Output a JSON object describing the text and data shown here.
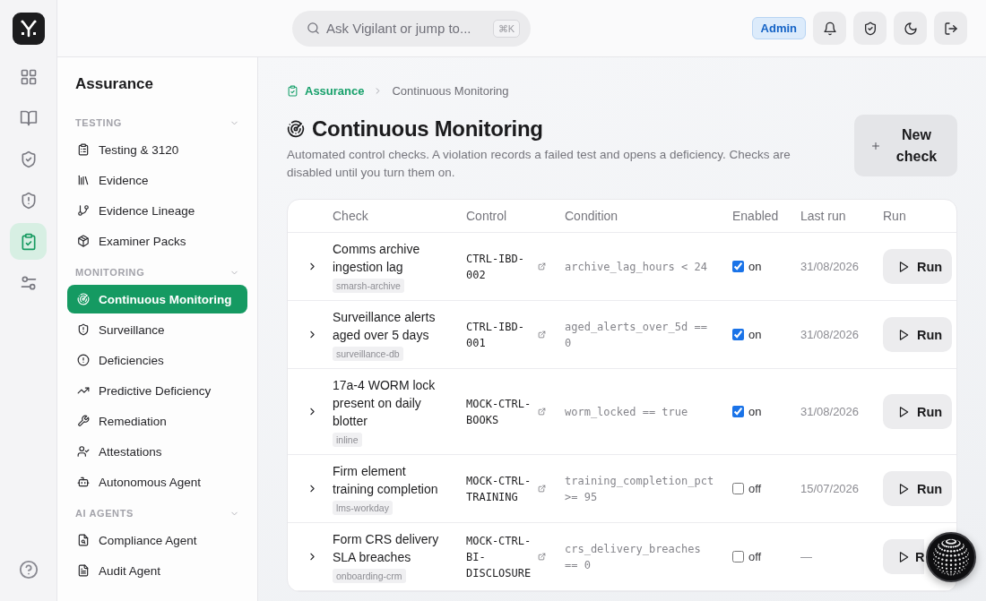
{
  "rail": {
    "items": [
      {
        "selected": false
      },
      {
        "selected": false
      },
      {
        "selected": false
      },
      {
        "selected": false
      },
      {
        "selected": true
      },
      {
        "selected": false
      }
    ]
  },
  "topbar": {
    "search": {
      "placeholder": "Ask Vigilant or jump to...",
      "shortcut": "⌘K"
    },
    "role_badge": "Admin"
  },
  "sidebar": {
    "title": "Assurance",
    "sections": [
      {
        "heading": "TESTING",
        "expanded": true,
        "items": [
          {
            "label": "Testing & 3120",
            "selected": false
          },
          {
            "label": "Evidence",
            "selected": false
          },
          {
            "label": "Evidence Lineage",
            "selected": false
          },
          {
            "label": "Examiner Packs",
            "selected": false
          }
        ]
      },
      {
        "heading": "MONITORING",
        "expanded": true,
        "items": [
          {
            "label": "Continuous Monitoring",
            "selected": true
          },
          {
            "label": "Surveillance",
            "selected": false
          },
          {
            "label": "Deficiencies",
            "selected": false
          },
          {
            "label": "Predictive Deficiency",
            "selected": false
          },
          {
            "label": "Remediation",
            "selected": false
          },
          {
            "label": "Attestations",
            "selected": false
          },
          {
            "label": "Autonomous Agent",
            "selected": false
          }
        ]
      },
      {
        "heading": "AI AGENTS",
        "expanded": true,
        "items": [
          {
            "label": "Compliance Agent",
            "selected": false
          },
          {
            "label": "Audit Agent",
            "selected": false
          }
        ]
      }
    ]
  },
  "breadcrumb": [
    {
      "label": "Assurance",
      "current": false
    },
    {
      "label": "Continuous Monitoring",
      "current": true
    }
  ],
  "page": {
    "title": "Continuous Monitoring",
    "description": "Automated control checks. A violation records a failed test and opens a deficiency. Checks are disabled until you turn them on.",
    "new_button": "New check"
  },
  "table": {
    "columns": [
      "Check",
      "Control",
      "Condition",
      "Enabled",
      "Last run",
      "Run"
    ],
    "rows": [
      {
        "expanded": false,
        "name": "Comms archive ingestion lag",
        "source": "smarsh-archive",
        "control": "CTRL-IBD-002",
        "condition": "archive_lag_hours < 24",
        "enabled": true,
        "enabled_label": "on",
        "last_run": "31/08/2026",
        "run_label": "Run"
      },
      {
        "expanded": false,
        "name": "Surveillance alerts aged over 5 days",
        "source": "surveillance-db",
        "control": "CTRL-IBD-001",
        "condition": "aged_alerts_over_5d == 0",
        "enabled": true,
        "enabled_label": "on",
        "last_run": "31/08/2026",
        "run_label": "Run"
      },
      {
        "expanded": false,
        "name": "17a-4 WORM lock present on daily blotter",
        "source": "inline",
        "control": "MOCK-CTRL-BOOKS",
        "condition": "worm_locked == true",
        "enabled": true,
        "enabled_label": "on",
        "last_run": "31/08/2026",
        "run_label": "Run"
      },
      {
        "expanded": false,
        "name": "Firm element training completion",
        "source": "lms-workday",
        "control": "MOCK-CTRL-TRAINING",
        "condition": "training_completion_pct >= 95",
        "enabled": false,
        "enabled_label": "off",
        "last_run": "15/07/2026",
        "run_label": "Run"
      },
      {
        "expanded": false,
        "name": "Form CRS delivery SLA breaches",
        "source": "onboarding-crm",
        "control": "MOCK-CTRL-BI-DISCLOSURE",
        "condition": "crs_delivery_breaches == 0",
        "enabled": false,
        "enabled_label": "off",
        "last_run": "—",
        "run_label": "R"
      }
    ]
  }
}
